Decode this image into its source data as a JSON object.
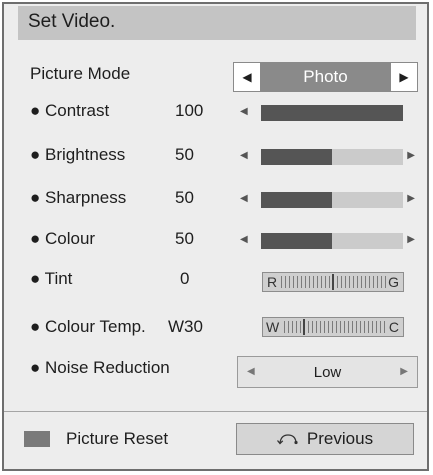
{
  "title": "Set Video.",
  "picture_mode": {
    "label": "Picture Mode",
    "value": "Photo"
  },
  "settings": [
    {
      "label": "● Contrast",
      "value": "100",
      "level": 1.0
    },
    {
      "label": "● Brightness",
      "value": "50",
      "level": 0.5
    },
    {
      "label": "● Sharpness",
      "value": "50",
      "level": 0.5
    },
    {
      "label": "● Colour",
      "value": "50",
      "level": 0.5
    }
  ],
  "tint": {
    "label": "● Tint",
    "value": "0",
    "left": "R",
    "right": "G"
  },
  "colour_temp": {
    "label": "● Colour Temp.",
    "value": "W30",
    "left": "W",
    "right": "C"
  },
  "noise_reduction": {
    "label": "● Noise Reduction",
    "value": "Low"
  },
  "footer": {
    "reset_label": "Picture Reset",
    "previous_label": "Previous"
  },
  "colors": {
    "panel": "#ededed",
    "title_bar": "#c4c4c4",
    "highlight": "#8a8a8a",
    "fill": "#555555",
    "track": "#cbcbcb"
  }
}
